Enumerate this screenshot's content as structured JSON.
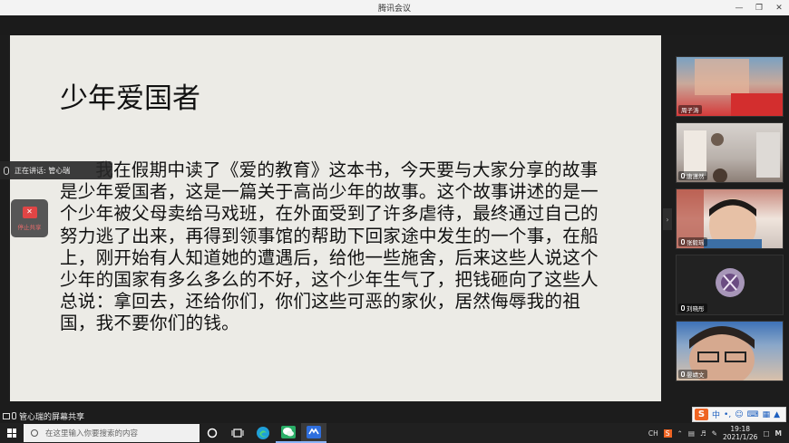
{
  "window": {
    "title": "腾讯会议"
  },
  "slide": {
    "title": "少年爱国者",
    "body": "我在假期中读了《爱的教育》这本书，今天要与大家分享的故事是少年爱国者，这是一篇关于高尚少年的故事。这个故事讲述的是一个少年被父母卖给马戏班，在外面受到了许多虐待，最终通过自己的努力逃了出来，再得到领事馆的帮助下回家途中发生的一个事，在船上，刚开始有人知道她的遭遇后，给他一些施舍，后来这些人说这个少年的国家有多么多么的不好，这个少年生气了，把钱砸向了这些人总说：拿回去，还给你们，你们这些可恶的家伙，居然侮辱我的祖国，我不要你们的钱。"
  },
  "speaking": {
    "label": "正在讲话: 管心瑞"
  },
  "stop_share": {
    "label": "停止共享"
  },
  "participants": [
    {
      "name": "周子涛"
    },
    {
      "name": "唐潇然"
    },
    {
      "name": "张毅瑶"
    },
    {
      "name": "刘晓彤"
    },
    {
      "name": "晏靖文"
    }
  ],
  "screen_share": {
    "label": "管心瑞的屏幕共享"
  },
  "ime": {
    "logo": "S",
    "mode": "中"
  },
  "taskbar": {
    "search_placeholder": "在这里输入你要搜索的内容",
    "time": "19:18",
    "date": "2021/1/26",
    "lang": "CH"
  },
  "colors": {
    "stop_share": "#e04545",
    "wechat": "#2aae67",
    "meeting": "#2f6fde",
    "edge": "#1fa0d8"
  }
}
